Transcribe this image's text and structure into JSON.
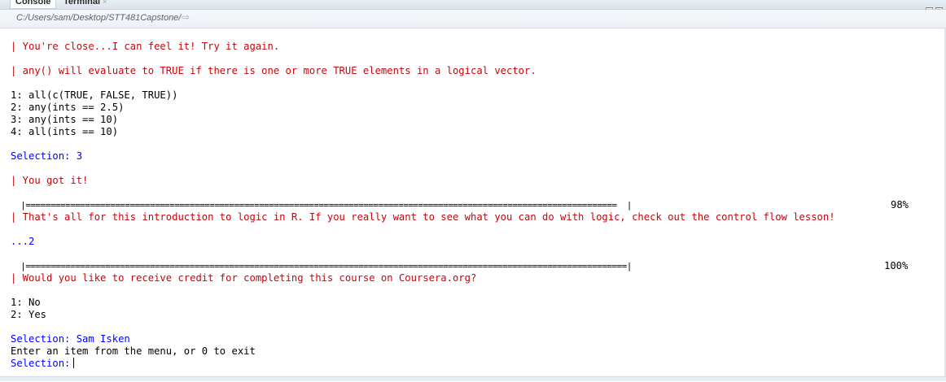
{
  "tabs": [
    {
      "label": "Console"
    },
    {
      "label": "Terminal",
      "close": "×"
    }
  ],
  "path": "C:/Users/sam/Desktop/STT481Capstone/",
  "console": {
    "msg_close": "| You're close...I can feel it! Try it again.",
    "msg_any": "| any() will evaluate to TRUE if there is one or more TRUE elements in a logical vector.",
    "options1": [
      "1: all(c(TRUE, FALSE, TRUE))",
      "2: any(ints == 2.5)",
      "3: any(ints == 10)",
      "4: all(ints == 10)"
    ],
    "selection1": "Selection: 3",
    "msg_got": "| You got it!",
    "progress1_bar": "  |=======================================================================================================================  |",
    "progress1_pct": "98%",
    "msg_end": "| That's all for this introduction to logic in R. If you really want to see what you can do with logic, check out the control flow lesson!",
    "cont": "...2",
    "progress2_bar": "  |=========================================================================================================================|",
    "progress2_pct": "100%",
    "msg_credit": "| Would you like to receive credit for completing this course on Coursera.org?",
    "options2": [
      "1: No",
      "2: Yes"
    ],
    "selection2": "Selection: Sam Isken",
    "enter_msg": "Enter an item from the menu, or 0 to exit",
    "prompt": "Selection:",
    "progress1_value": 98,
    "progress2_value": 100
  },
  "colors": {
    "message": "#c5060b",
    "input": "#0000ff",
    "output": "#000000"
  }
}
